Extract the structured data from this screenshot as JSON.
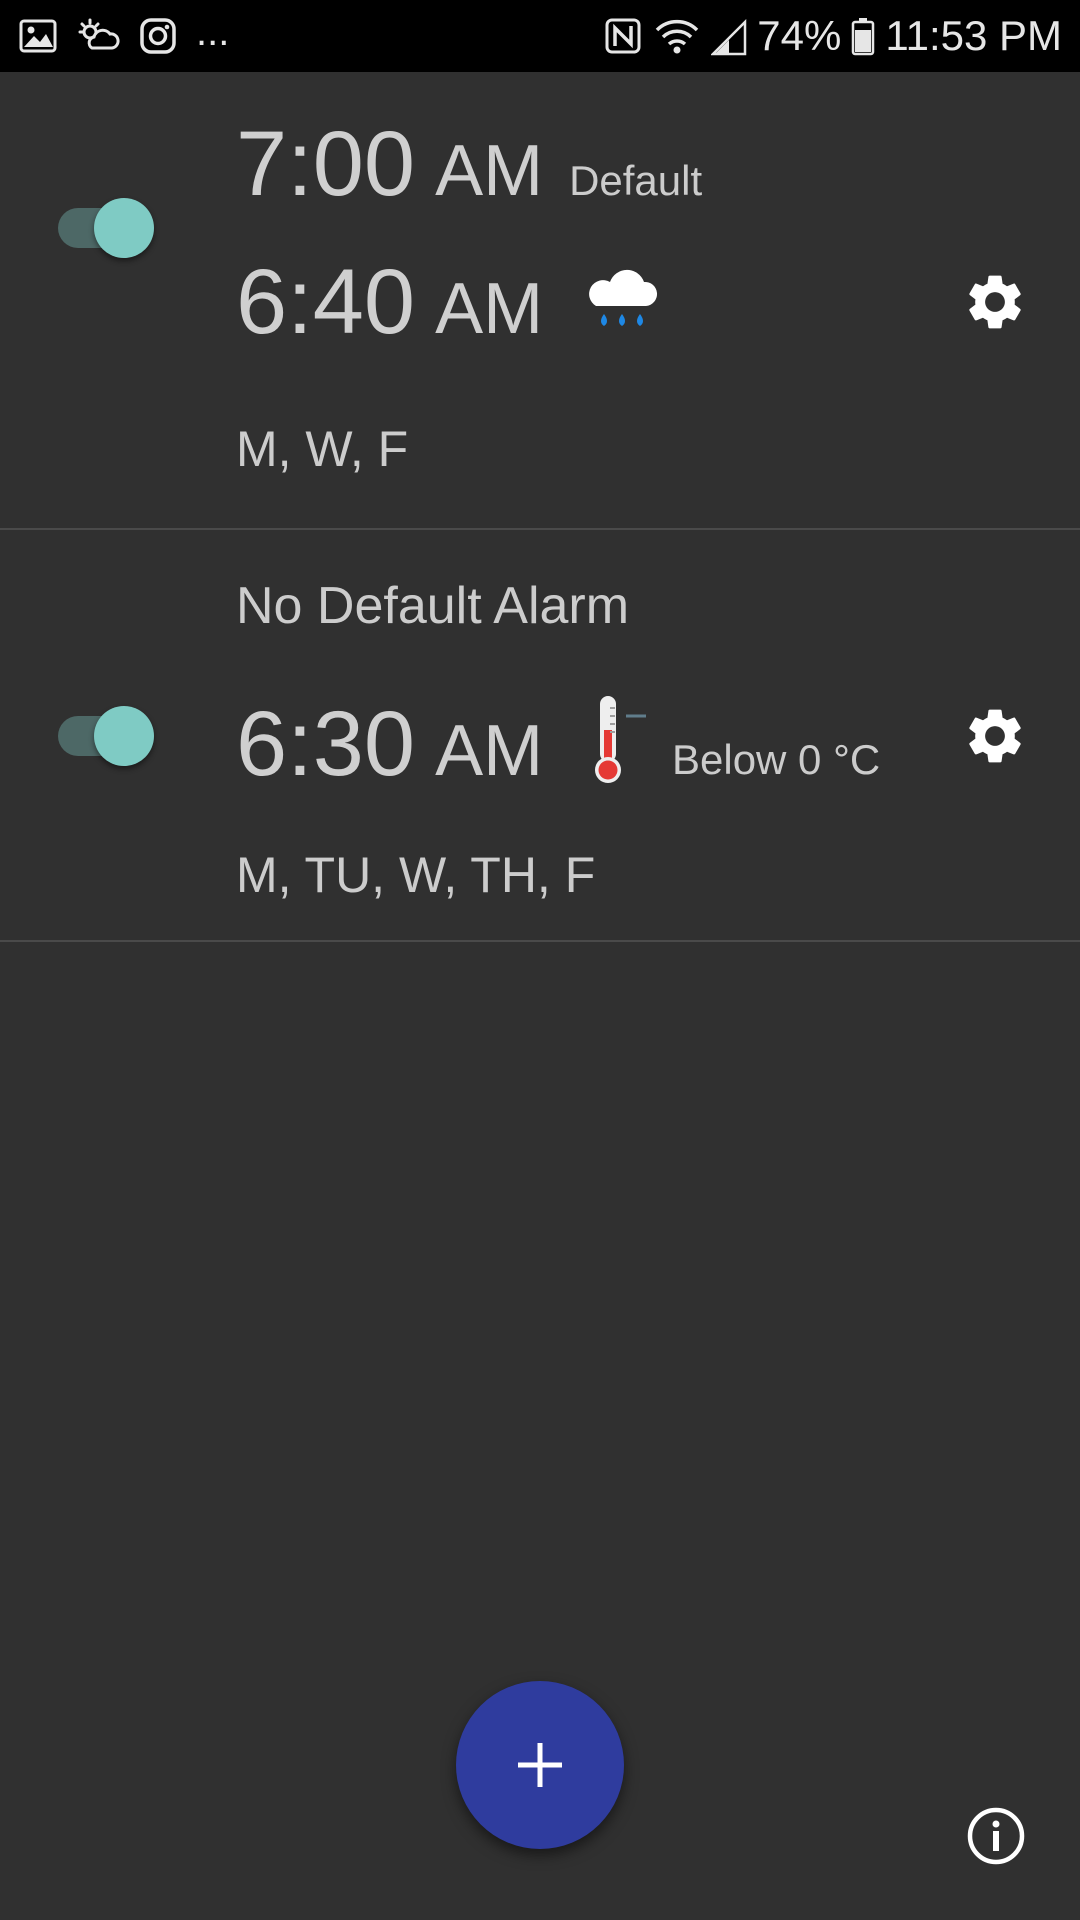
{
  "status_bar": {
    "overflow": "...",
    "battery": "74%",
    "time": "11:53 PM",
    "icons_left": [
      "gallery-icon",
      "weather-icon",
      "instagram-icon"
    ],
    "icons_right": [
      "nfc-icon",
      "wifi-icon",
      "signal-icon",
      "battery-icon"
    ]
  },
  "alarms": [
    {
      "default_time": "7:00",
      "default_ampm": "AM",
      "default_label": "Default",
      "time": "6:40",
      "ampm": "AM",
      "enabled": true,
      "condition_icon": "rain-cloud-icon",
      "days": "M, W, F"
    },
    {
      "no_default_label": "No Default Alarm",
      "time": "6:30",
      "ampm": "AM",
      "enabled": true,
      "condition_icon": "thermometer-icon",
      "condition_text": "Below 0 °C",
      "days": "M, TU, W, TH, F"
    }
  ],
  "fab": {
    "label": "+",
    "icon": "plus-icon"
  },
  "colors": {
    "background": "#303030",
    "toggle_thumb": "#7fcbc4",
    "toggle_track": "#4d6866",
    "fab": "#2f3c9e",
    "rain": "#1e88e5",
    "thermo_red": "#e53935"
  }
}
